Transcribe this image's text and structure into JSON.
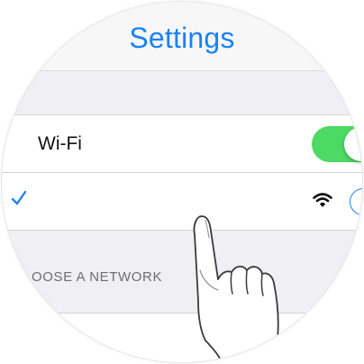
{
  "nav": {
    "title": "Settings",
    "title_color": "#1a82f7"
  },
  "wifi": {
    "label": "Wi-Fi",
    "toggle_on": true,
    "toggle_color": "#4cd964"
  },
  "connected_network": {
    "selected_icon": "checkmark-icon",
    "signal_icon": "wifi-signal-icon",
    "info_icon": "info-icon"
  },
  "networks_section": {
    "header": "OOSE A NETWORK"
  },
  "overlay": {
    "icon": "pointing-hand-icon"
  }
}
